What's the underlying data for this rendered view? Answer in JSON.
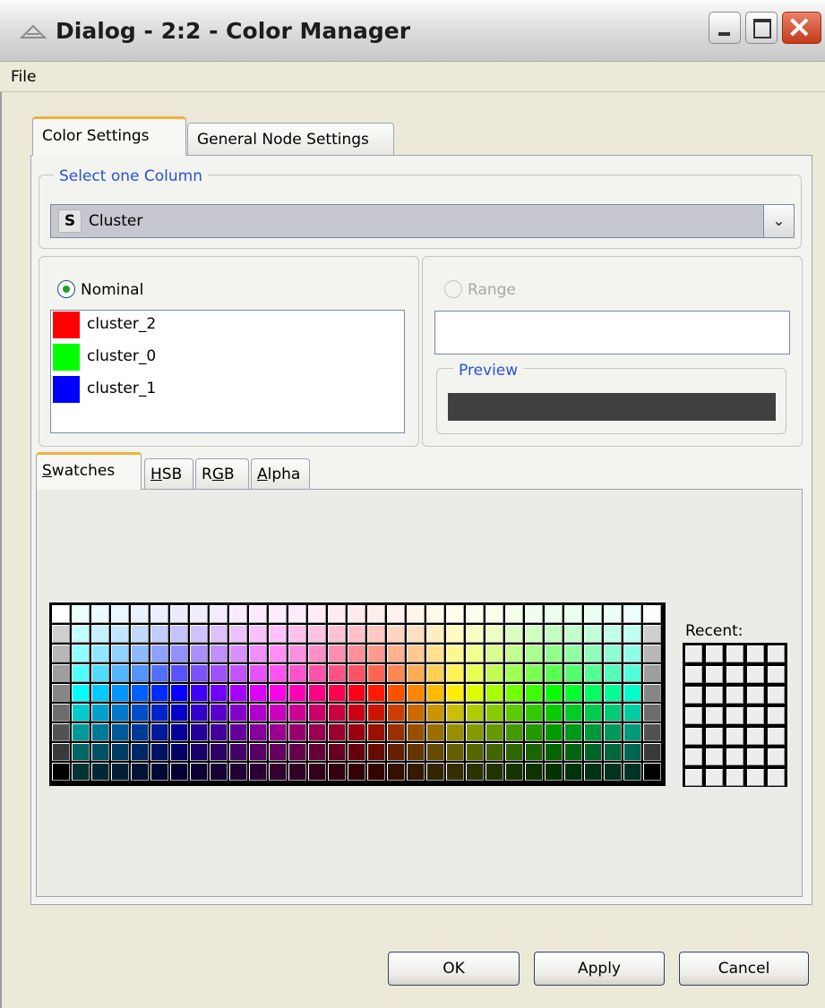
{
  "window": {
    "title": "Dialog - 2:2 - Color Manager"
  },
  "menu": {
    "file": "File"
  },
  "tabs": {
    "color_settings": "Color Settings",
    "general_node_settings": "General Node Settings"
  },
  "column_select": {
    "legend": "Select one Column",
    "type_badge": "S",
    "value": "Cluster"
  },
  "nominal": {
    "label": "Nominal",
    "selected": true,
    "items": [
      {
        "label": "cluster_2",
        "color": "#ff0000"
      },
      {
        "label": "cluster_0",
        "color": "#00ff00"
      },
      {
        "label": "cluster_1",
        "color": "#0000ff"
      }
    ]
  },
  "range": {
    "label": "Range",
    "enabled": false,
    "preview_legend": "Preview",
    "preview_color": "#404040"
  },
  "chooser_tabs": {
    "swatches": "Swatches",
    "hsb": "HSB",
    "rgb": "RGB",
    "alpha": "Alpha",
    "active": "swatches"
  },
  "swatches": {
    "recent_label": "Recent:"
  },
  "buttons": {
    "ok": "OK",
    "apply": "Apply",
    "cancel": "Cancel"
  }
}
